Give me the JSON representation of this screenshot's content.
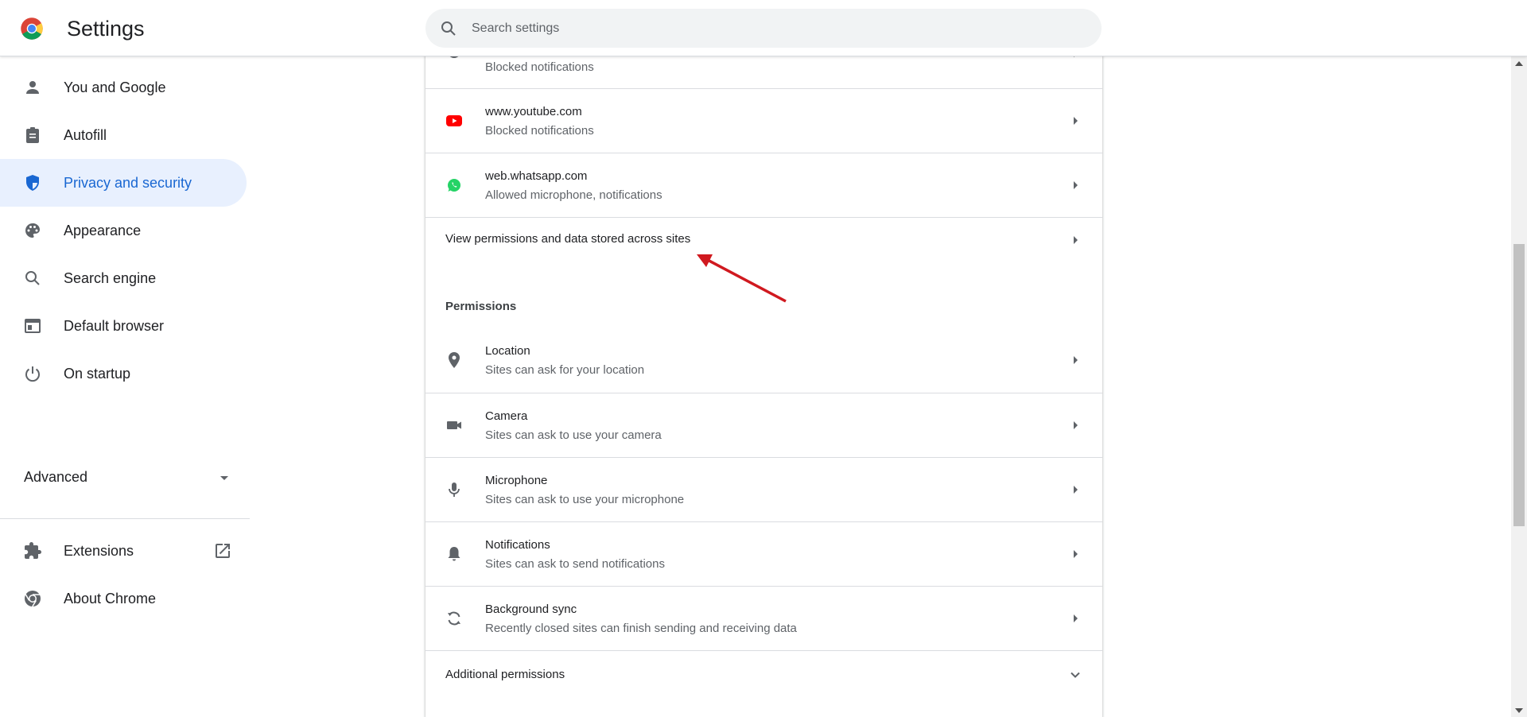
{
  "app": {
    "title": "Settings"
  },
  "search": {
    "placeholder": "Search settings"
  },
  "sidebar": {
    "items": [
      {
        "label": "You and Google",
        "icon": "person-icon"
      },
      {
        "label": "Autofill",
        "icon": "clipboard-icon"
      },
      {
        "label": "Privacy and security",
        "icon": "shield-icon",
        "active": true
      },
      {
        "label": "Appearance",
        "icon": "palette-icon"
      },
      {
        "label": "Search engine",
        "icon": "search-icon"
      },
      {
        "label": "Default browser",
        "icon": "browser-window-icon"
      },
      {
        "label": "On startup",
        "icon": "power-icon"
      }
    ],
    "advanced": {
      "label": "Advanced"
    },
    "bottom_items": [
      {
        "label": "Extensions",
        "icon": "puzzle-icon"
      },
      {
        "label": "About Chrome",
        "icon": "chrome-icon"
      }
    ]
  },
  "main": {
    "recent_sites": [
      {
        "subtitle": "Blocked notifications",
        "icon": "site-icon"
      },
      {
        "title": "www.youtube.com",
        "subtitle": "Blocked notifications",
        "icon": "youtube-icon"
      },
      {
        "title": "web.whatsapp.com",
        "subtitle": "Allowed microphone, notifications",
        "icon": "whatsapp-icon"
      }
    ],
    "view_permissions": "View permissions and data stored across sites",
    "permissions_heading": "Permissions",
    "permissions": [
      {
        "title": "Location",
        "subtitle": "Sites can ask for your location",
        "icon": "location-pin-icon"
      },
      {
        "title": "Camera",
        "subtitle": "Sites can ask to use your camera",
        "icon": "camera-icon"
      },
      {
        "title": "Microphone",
        "subtitle": "Sites can ask to use your microphone",
        "icon": "microphone-icon"
      },
      {
        "title": "Notifications",
        "subtitle": "Sites can ask to send notifications",
        "icon": "bell-icon"
      },
      {
        "title": "Background sync",
        "subtitle": "Recently closed sites can finish sending and receiving data",
        "icon": "sync-icon"
      }
    ],
    "additional_permissions": "Additional permissions"
  },
  "colors": {
    "accent": "#1967d2",
    "active_bg": "#e8f0fe",
    "annotation_arrow": "#d0191f",
    "youtube_red": "#ff0000",
    "whatsapp_green": "#25d366"
  }
}
